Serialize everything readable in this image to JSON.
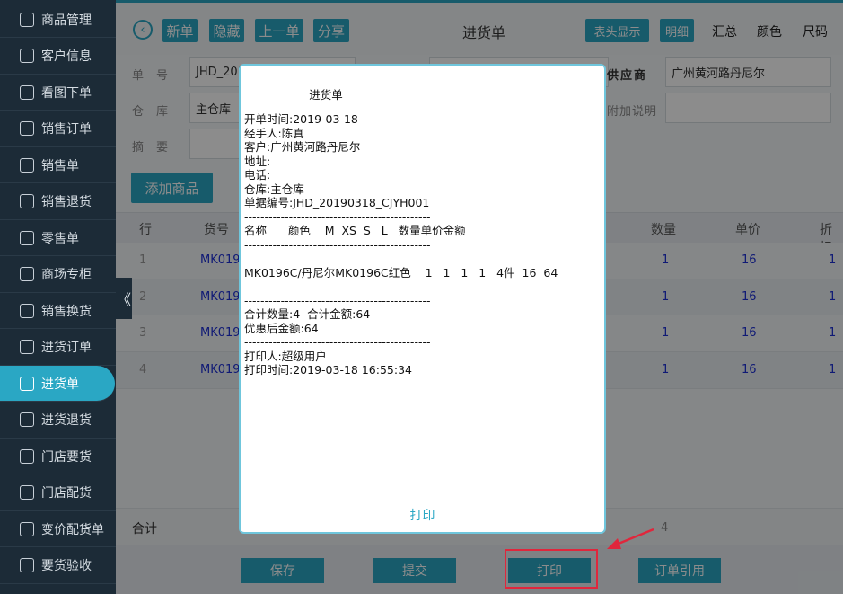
{
  "sidebar": {
    "items": [
      {
        "label": "商品管理",
        "icon": "product-icon"
      },
      {
        "label": "客户信息",
        "icon": "user-icon"
      },
      {
        "label": "看图下单",
        "icon": "image-order-icon"
      },
      {
        "label": "销售订单",
        "icon": "sales-order-icon"
      },
      {
        "label": "销售单",
        "icon": "sales-icon"
      },
      {
        "label": "销售退货",
        "icon": "sales-return-icon"
      },
      {
        "label": "零售单",
        "icon": "retail-icon"
      },
      {
        "label": "商场专柜",
        "icon": "mall-counter-icon"
      },
      {
        "label": "销售换货",
        "icon": "exchange-icon"
      },
      {
        "label": "进货订单",
        "icon": "purchase-order-icon"
      },
      {
        "label": "进货单",
        "icon": "purchase-icon",
        "active": true
      },
      {
        "label": "进货退货",
        "icon": "purchase-return-icon"
      },
      {
        "label": "门店要货",
        "icon": "store-request-icon"
      },
      {
        "label": "门店配货",
        "icon": "store-distribution-icon"
      },
      {
        "label": "变价配货单",
        "icon": "price-change-icon"
      },
      {
        "label": "要货验收",
        "icon": "acceptance-icon"
      }
    ]
  },
  "header": {
    "title": "进货单",
    "buttons": [
      "新单",
      "隐藏",
      "上一单",
      "分享"
    ],
    "right_buttons": [
      "表头显示",
      "明细"
    ],
    "right_texts": [
      "汇总",
      "颜色",
      "尺码"
    ]
  },
  "form": {
    "doc_no_label": "单号",
    "doc_no_value": "JHD_201",
    "warehouse_label": "仓库",
    "warehouse_value": "主仓库",
    "summary_label": "摘要",
    "supplier_label": "供应商",
    "supplier_value": "广州黄河路丹尼尔",
    "note_label": "附加说明"
  },
  "add_button": "添加商品",
  "table": {
    "headers": [
      "行",
      "货号",
      "数量",
      "单价",
      "折扣"
    ],
    "rows": [
      {
        "idx": "1",
        "code": "MK019",
        "qty": "1",
        "price": "16",
        "disc": "1"
      },
      {
        "idx": "2",
        "code": "MK019",
        "qty": "1",
        "price": "16",
        "disc": "1"
      },
      {
        "idx": "3",
        "code": "MK019",
        "qty": "1",
        "price": "16",
        "disc": "1"
      },
      {
        "idx": "4",
        "code": "MK019",
        "qty": "1",
        "price": "16",
        "disc": "1"
      }
    ],
    "total_label": "合计",
    "total_qty": "4"
  },
  "footer": {
    "save": "保存",
    "submit": "提交",
    "print": "打印",
    "reference": "订单引用"
  },
  "modal": {
    "title": "进货单",
    "lines": [
      "开单时间:2019-03-18",
      "经手人:陈真",
      "客户:广州黄河路丹尼尔",
      "地址:",
      "电话:",
      "仓库:主仓库",
      "单据编号:JHD_20190318_CJYH001",
      "----------------------------------------------",
      "名称      颜色    M  XS  S   L   数量单价金额",
      "----------------------------------------------",
      "",
      "MK0196C/丹尼尔MK0196C红色    1   1   1   1   4件  16  64",
      "",
      "----------------------------------------------",
      "合计数量:4  合计金额:64",
      "优惠后金额:64",
      "----------------------------------------------",
      "打印人:超级用户",
      "打印时间:2019-03-18 16:55:34"
    ],
    "print_button": "打印"
  },
  "colors": {
    "accent": "#2aa7c4",
    "sidebar_bg": "#1c2b37",
    "highlight": "#e0263c"
  }
}
